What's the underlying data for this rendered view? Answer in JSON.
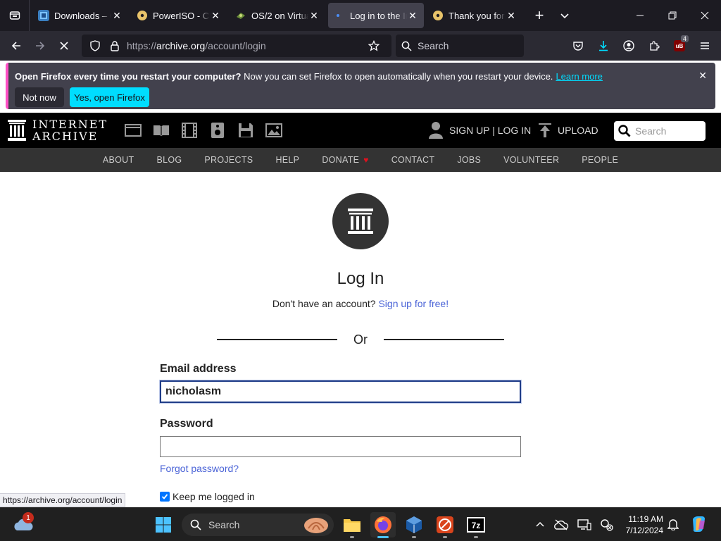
{
  "browser": {
    "tabs": [
      {
        "title": "Downloads – OS/2 Museum",
        "active": false
      },
      {
        "title": "PowerISO - Create, Edit",
        "active": false
      },
      {
        "title": "OS/2 on VirtualBox",
        "active": false
      },
      {
        "title": "Log in to the Internet Archive",
        "active": true
      },
      {
        "title": "Thank you for installing",
        "active": false
      }
    ],
    "url_prefix": "https://",
    "url_domain": "archive.org",
    "url_path": "/account/login",
    "search_placeholder": "Search",
    "extension_badge": "4"
  },
  "notification": {
    "bold_text": "Open Firefox every time you restart your computer?",
    "text": " Now you can set Firefox to open automatically when you restart your device.",
    "link": "Learn more",
    "not_now": "Not now",
    "yes": "Yes, open Firefox"
  },
  "ia": {
    "logo_line1": "INTERNET",
    "logo_line2": "ARCHIVE",
    "signup_login": "SIGN UP | LOG IN",
    "upload": "UPLOAD",
    "search_placeholder": "Search",
    "nav": [
      "ABOUT",
      "BLOG",
      "PROJECTS",
      "HELP",
      "DONATE",
      "CONTACT",
      "JOBS",
      "VOLUNTEER",
      "PEOPLE"
    ]
  },
  "login": {
    "title": "Log In",
    "no_account": "Don't have an account?",
    "signup_link": "Sign up for free!",
    "or": "Or",
    "email_label": "Email address",
    "email_value": "nicholasm",
    "password_label": "Password",
    "password_value": "",
    "forgot": "Forgot password?",
    "keep_logged": "Keep me logged in",
    "keep_checked": true
  },
  "status_bar_url": "https://archive.org/account/login",
  "taskbar": {
    "weather_badge": "1",
    "search_placeholder": "Search",
    "time": "11:19 AM",
    "date": "7/12/2024"
  },
  "colors": {
    "accent_cyan": "#00ddff",
    "link_blue": "#4b64d7",
    "donate_heart": "#e1111e",
    "notif_stripe": "#ff4fc5"
  }
}
